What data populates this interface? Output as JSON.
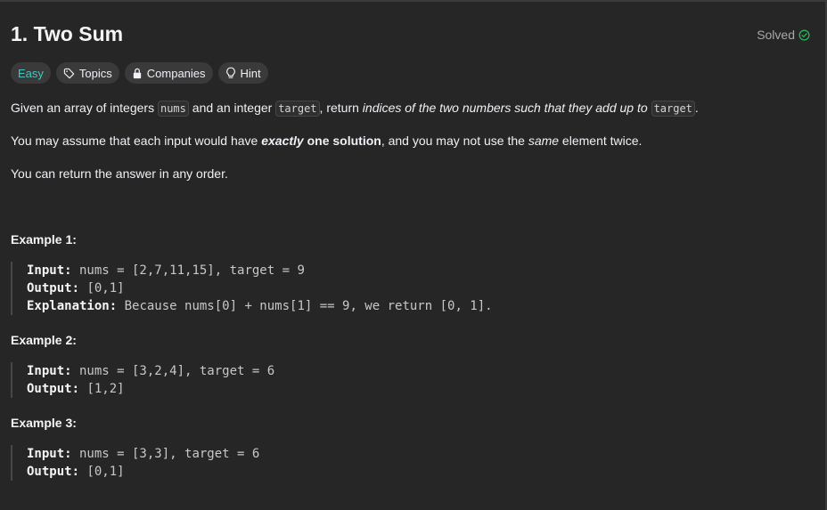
{
  "problem": {
    "title": "1. Two Sum",
    "status": "Solved"
  },
  "tags": {
    "difficulty": "Easy",
    "topics": "Topics",
    "companies": "Companies",
    "hint": "Hint"
  },
  "description": {
    "p1": {
      "a": "Given an array of integers ",
      "code1": "nums",
      "b": " and an integer ",
      "code2": "target",
      "c": ", return ",
      "em": "indices of the two numbers such that they add up to",
      "d": " ",
      "code3": "target",
      "e": "."
    },
    "p2": {
      "a": "You may assume that each input would have ",
      "strong": "exactly",
      "strong2": " one solution",
      "b": ", and you may not use the ",
      "em": "same",
      "c": " element twice."
    },
    "p3": "You can return the answer in any order."
  },
  "examples": [
    {
      "title": "Example 1:",
      "input_label": "Input:",
      "input": " nums = [2,7,11,15], target = 9",
      "output_label": "Output:",
      "output": " [0,1]",
      "explanation_label": "Explanation:",
      "explanation": " Because nums[0] + nums[1] == 9, we return [0, 1]."
    },
    {
      "title": "Example 2:",
      "input_label": "Input:",
      "input": " nums = [3,2,4], target = 6",
      "output_label": "Output:",
      "output": " [1,2]"
    },
    {
      "title": "Example 3:",
      "input_label": "Input:",
      "input": " nums = [3,3], target = 6",
      "output_label": "Output:",
      "output": " [0,1]"
    }
  ],
  "colors": {
    "background": "#262626",
    "easy": "#46c6c2",
    "solved_check": "#2cbb5d"
  }
}
